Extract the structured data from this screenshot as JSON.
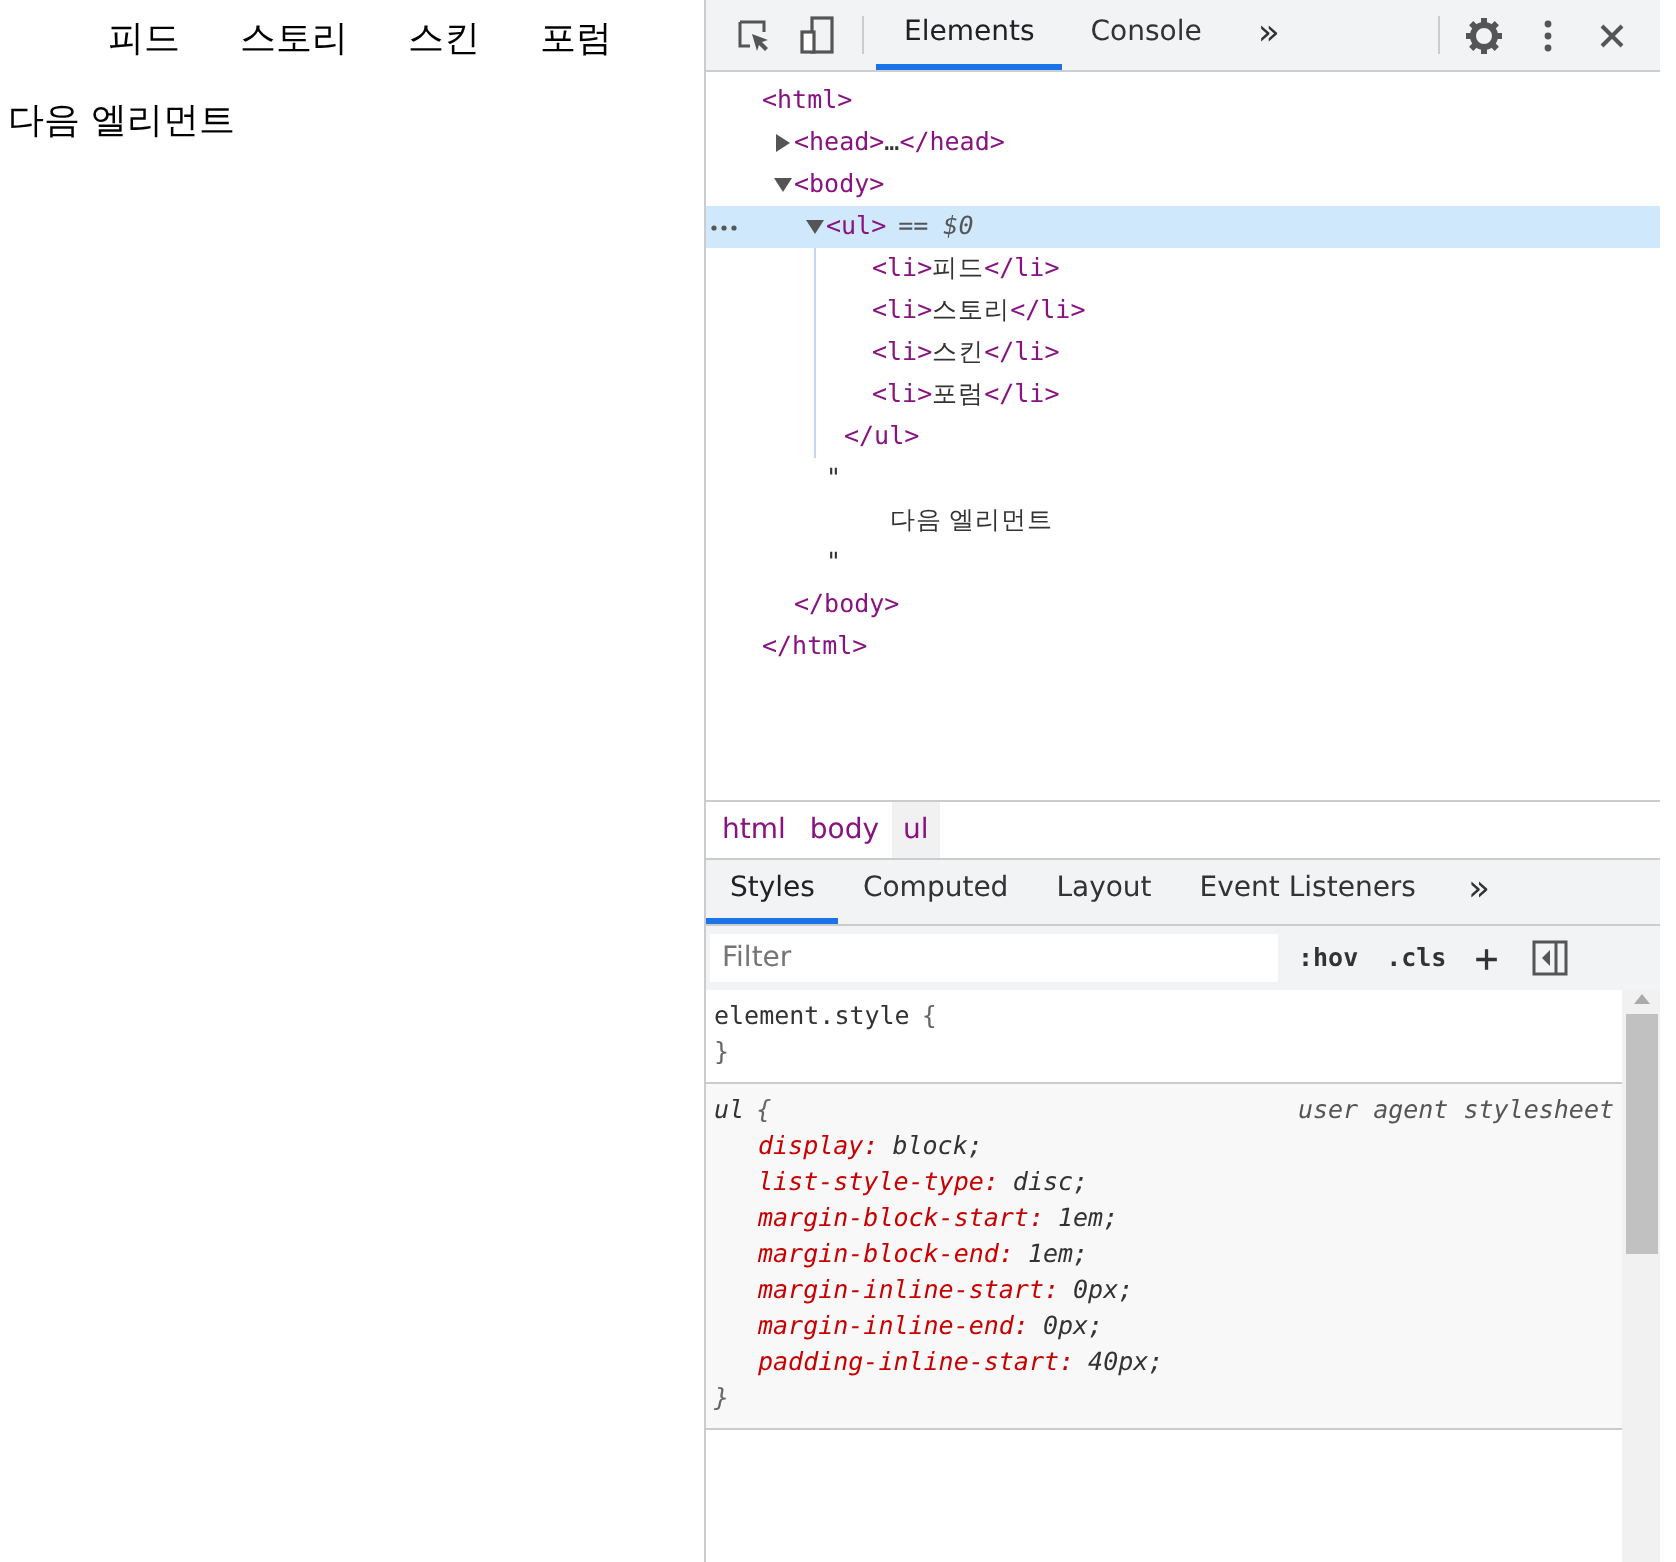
{
  "page": {
    "nav_items": [
      "피드",
      "스토리",
      "스킨",
      "포럼"
    ],
    "next_text": "다음 엘리먼트"
  },
  "devtools": {
    "toolbar": {
      "tabs": [
        {
          "label": "Elements",
          "selected": true
        },
        {
          "label": "Console",
          "selected": false
        }
      ],
      "more": "»"
    },
    "dom_tree": [
      {
        "kind": "element",
        "open": "<html>",
        "close": "</html>",
        "selected": false,
        "children": [
          {
            "kind": "collapsed",
            "open": "<head>",
            "ellipsis": "…",
            "close": "</head>",
            "expanded": false,
            "selected": false
          },
          {
            "kind": "element",
            "open": "<body>",
            "close": "</body>",
            "expanded": true,
            "selected": false,
            "children": [
              {
                "kind": "element",
                "open": "<ul>",
                "marker": "== $0",
                "close": "</ul>",
                "expanded": true,
                "selected": true,
                "children": [
                  {
                    "kind": "inline",
                    "open": "<li>",
                    "text": "피드",
                    "close": "</li>"
                  },
                  {
                    "kind": "inline",
                    "open": "<li>",
                    "text": "스토리",
                    "close": "</li>"
                  },
                  {
                    "kind": "inline",
                    "open": "<li>",
                    "text": "스킨",
                    "close": "</li>"
                  },
                  {
                    "kind": "inline",
                    "open": "<li>",
                    "text": "포럼",
                    "close": "</li>"
                  }
                ]
              },
              {
                "kind": "text",
                "lines": [
                  "\"",
                  "다음 엘리먼트",
                  "\""
                ]
              }
            ]
          }
        ]
      }
    ],
    "breadcrumbs": [
      {
        "label": "html",
        "selected": false
      },
      {
        "label": "body",
        "selected": false
      },
      {
        "label": "ul",
        "selected": true
      }
    ],
    "styles_tabs": [
      {
        "label": "Styles",
        "selected": true
      },
      {
        "label": "Computed",
        "selected": false
      },
      {
        "label": "Layout",
        "selected": false
      },
      {
        "label": "Event Listeners",
        "selected": false
      }
    ],
    "styles_more": "»",
    "filter": {
      "placeholder": "Filter"
    },
    "filter_buttons": [
      ":hov",
      ".cls"
    ],
    "add_rule": "+",
    "rules": [
      {
        "selector": "element.style",
        "open": "{",
        "close": "}"
      },
      {
        "selector": "ul",
        "source": "user agent stylesheet",
        "open": "{",
        "close": "}",
        "declarations": [
          {
            "property": "display:",
            "value": "block;"
          },
          {
            "property": "list-style-type:",
            "value": "disc;"
          },
          {
            "property": "margin-block-start:",
            "value": "1em;"
          },
          {
            "property": "margin-block-end:",
            "value": "1em;"
          },
          {
            "property": "margin-inline-start:",
            "value": "0px;"
          },
          {
            "property": "margin-inline-end:",
            "value": "0px;"
          },
          {
            "property": "padding-inline-start:",
            "value": "40px;"
          }
        ]
      }
    ]
  }
}
